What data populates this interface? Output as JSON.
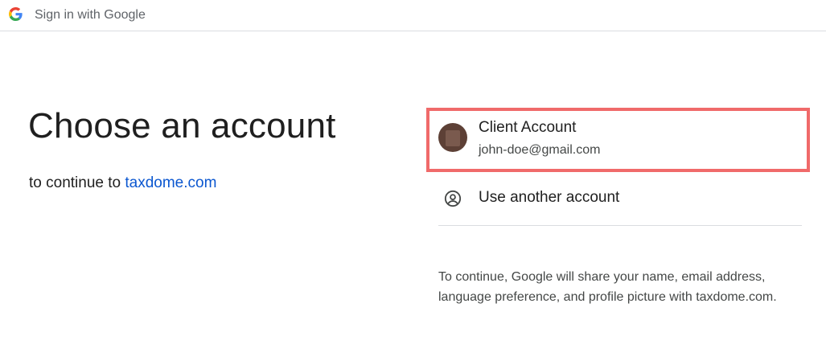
{
  "topbar": {
    "title": "Sign in with Google",
    "logo_icon": "google-g-icon"
  },
  "main": {
    "heading": "Choose an account",
    "subtitle_prefix": "to continue to",
    "subtitle_link": "taxdome.com"
  },
  "accounts": [
    {
      "name": "Client Account",
      "email": "john-doe@gmail.com",
      "avatar_color": "#5d4036"
    }
  ],
  "use_another": {
    "label": "Use another account",
    "icon": "account-circle-icon"
  },
  "disclaimer": {
    "text": "To continue, Google will share your name, email address, language preference, and profile picture with taxdome.com."
  },
  "colors": {
    "link": "#0b57d0",
    "highlight_border": "#f06a6a",
    "divider": "#dadce0"
  }
}
